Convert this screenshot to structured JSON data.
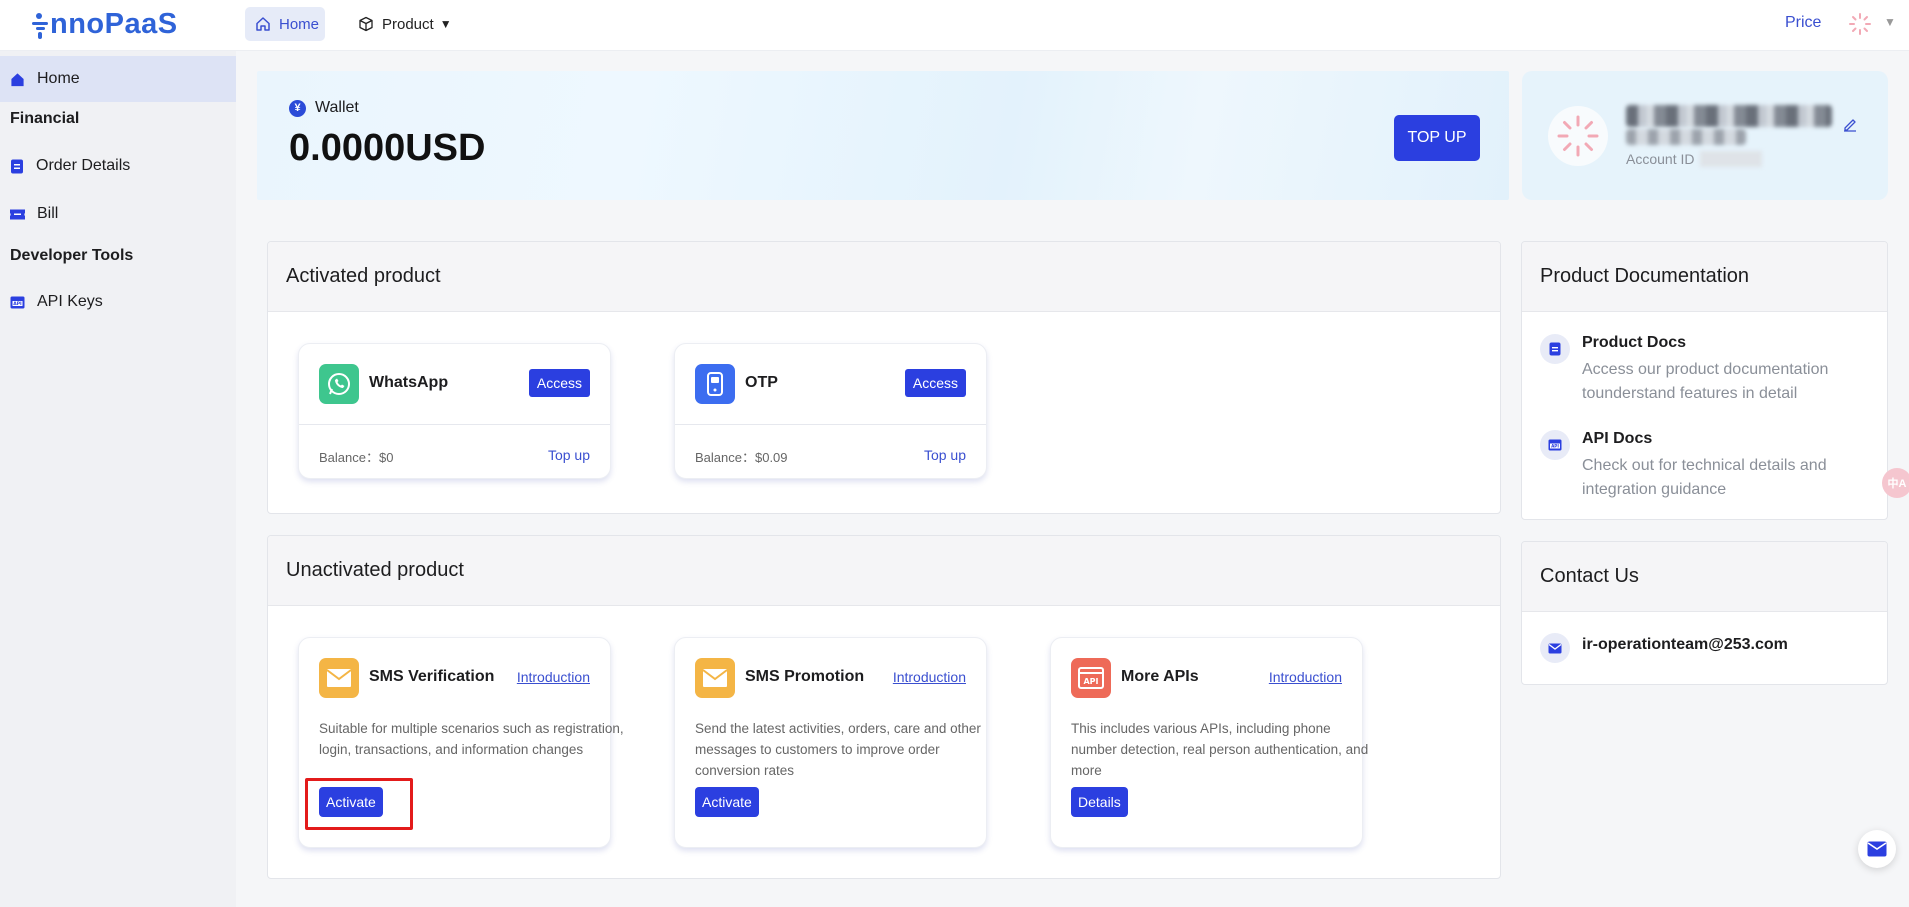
{
  "brand": {
    "logo_text": "nnoPaaS",
    "accent": "#2b3fe0",
    "logo_color": "#2f63d8"
  },
  "topnav": {
    "home_label": "Home",
    "product_label": "Product",
    "price_label": "Price"
  },
  "sidebar": {
    "items": [
      {
        "label": "Home",
        "icon": "home-icon",
        "active": true
      },
      {
        "section": "Financial"
      },
      {
        "label": "Order Details",
        "icon": "document-icon"
      },
      {
        "label": "Bill",
        "icon": "ticket-icon"
      },
      {
        "section": "Developer Tools"
      },
      {
        "label": "API Keys",
        "icon": "api-icon"
      }
    ]
  },
  "wallet": {
    "label": "Wallet",
    "currency_symbol": "¥",
    "amount": "0.0000USD",
    "topup_label": "TOP UP"
  },
  "account": {
    "id_label": "Account ID"
  },
  "activated": {
    "title": "Activated product",
    "products": [
      {
        "name": "WhatsApp",
        "action": "Access",
        "balance": "Balance：$0",
        "topup": "Top up",
        "icon": "whatsapp-icon"
      },
      {
        "name": "OTP",
        "action": "Access",
        "balance": "Balance：$0.09",
        "topup": "Top up",
        "icon": "otp-icon"
      }
    ]
  },
  "unactivated": {
    "title": "Unactivated product",
    "products": [
      {
        "name": "SMS Verification",
        "link": "Introduction",
        "description": "Suitable for multiple scenarios such as registration, login, transactions, and information changes",
        "action": "Activate",
        "icon": "envelope-icon"
      },
      {
        "name": "SMS Promotion",
        "link": "Introduction",
        "description": "Send the latest activities, orders, care and other messages to customers to improve order conversion rates",
        "action": "Activate",
        "icon": "envelope-icon"
      },
      {
        "name": "More APIs",
        "link": "Introduction",
        "description": "This includes various APIs, including phone number detection, real person authentication, and more",
        "action": "Details",
        "icon": "api-icon"
      }
    ]
  },
  "docs": {
    "title": "Product Documentation",
    "items": [
      {
        "title": "Product Docs",
        "description": "Access our product documentation tounderstand features in detail",
        "icon": "document-icon"
      },
      {
        "title": "API Docs",
        "description": "Check out for technical details and integration guidance",
        "icon": "api-icon"
      }
    ]
  },
  "contact": {
    "title": "Contact Us",
    "email": "ir-operationteam@253.com"
  },
  "floating": {
    "translate_label": "中A"
  }
}
